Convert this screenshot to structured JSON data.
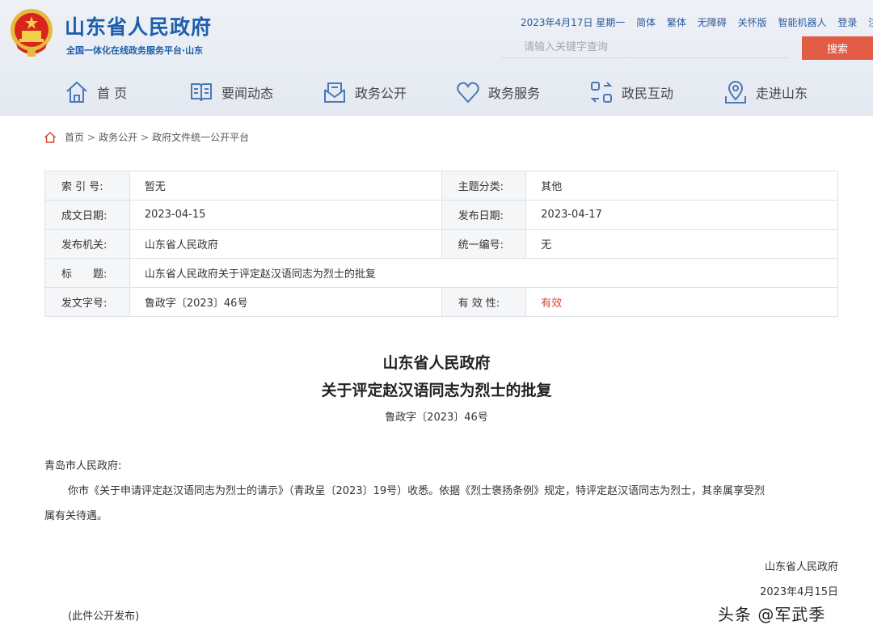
{
  "header": {
    "site_title": "山东省人民政府",
    "site_subtitle": "全国一体化在线政务服务平台·山东",
    "top_links": {
      "date": "2023年4月17日 星期一",
      "simplified": "简体",
      "traditional": "繁体",
      "accessibility": "无障碍",
      "elderly": "关怀版",
      "robot": "智能机器人",
      "login": "登录",
      "register": "注册"
    },
    "search": {
      "placeholder": "请输入关键字查询",
      "button": "搜索"
    },
    "nav": [
      "首 页",
      "要闻动态",
      "政务公开",
      "政务服务",
      "政民互动",
      "走进山东"
    ]
  },
  "breadcrumb": [
    "首页",
    "政务公开",
    "政府文件统一公开平台"
  ],
  "meta": {
    "index_label": "索 引 号:",
    "index_value": "暂无",
    "topic_label": "主题分类:",
    "topic_value": "其他",
    "written_label": "成文日期:",
    "written_value": "2023-04-15",
    "published_label": "发布日期:",
    "published_value": "2023-04-17",
    "issuer_label": "发布机关:",
    "issuer_value": "山东省人民政府",
    "code_label": "统一编号:",
    "code_value": "无",
    "title_label": "标　　题:",
    "title_value": "山东省人民政府关于评定赵汉语同志为烈士的批复",
    "docno_label": "发文字号:",
    "docno_value": "鲁政字〔2023〕46号",
    "validity_label": "有 效 性:",
    "validity_value": "有效",
    "validity_color": "#d9432f"
  },
  "document": {
    "title_line1": "山东省人民政府",
    "title_line2": "关于评定赵汉语同志为烈士的批复",
    "number": "鲁政字〔2023〕46号",
    "addressee": "青岛市人民政府:",
    "body_line1": "你市《关于申请评定赵汉语同志为烈士的请示》（青政呈〔2023〕19号）收悉。依据《烈士褒扬条例》规定，特评定赵汉语同志为烈士，其亲属享受烈",
    "body_line2": "属有关待遇。",
    "signature": "山东省人民政府",
    "date": "2023年4月15日",
    "note": "(此件公开发布)"
  },
  "watermark": "头条 @军武季"
}
